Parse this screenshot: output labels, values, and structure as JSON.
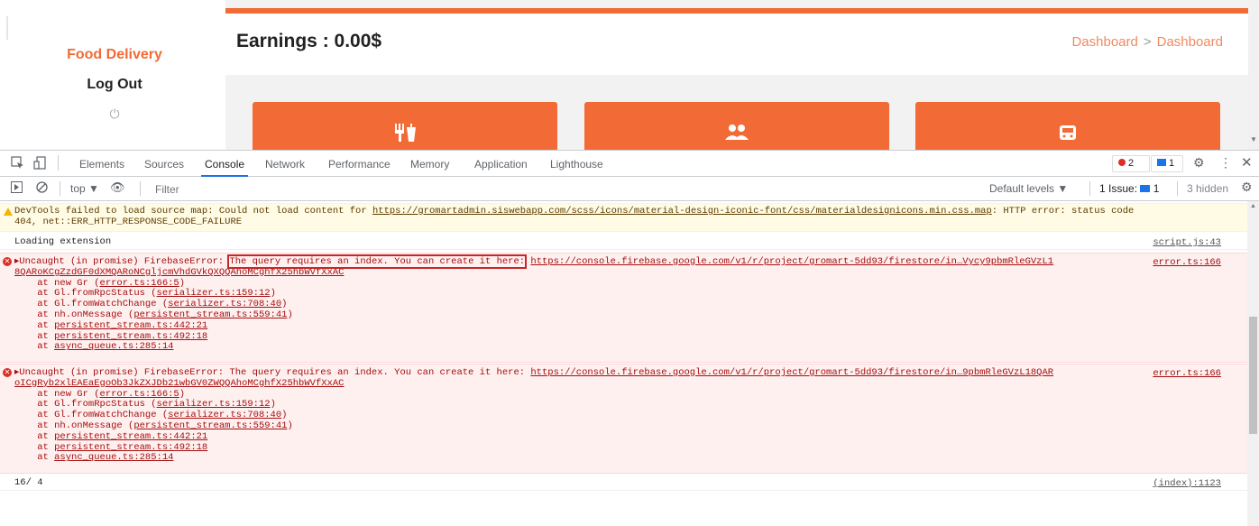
{
  "page": {
    "brand": "Food Delivery",
    "logout_label": "Log Out",
    "earnings_title": "Earnings : 0.00$",
    "breadcrumb": [
      "Dashboard",
      "Dashboard"
    ],
    "accent_color": "#f26a35",
    "cards": [
      {
        "icon": "utensils-icon"
      },
      {
        "icon": "users-icon"
      },
      {
        "icon": "car-icon"
      }
    ]
  },
  "devtools": {
    "tabs": [
      "Elements",
      "Sources",
      "Console",
      "Network",
      "Performance",
      "Memory",
      "Application",
      "Lighthouse"
    ],
    "active_tab": "Console",
    "error_count": "2",
    "message_count": "1",
    "context": "top ▼",
    "filter_placeholder": "Filter",
    "default_levels": "Default levels ▼",
    "issues_label": "1 Issue:",
    "issues_count": "1",
    "hidden_label": "3 hidden",
    "messages": {
      "warning": {
        "line1_prefix": "DevTools failed to load source map: Could not load content for ",
        "line1_link": "https://gromartadmin.siswebapp.com/scss/icons/material-design-iconic-font/css/materialdesignicons.min.css.map",
        "line1_suffix": ": HTTP error: status code",
        "line2": "404, net::ERR_HTTP_RESPONSE_CODE_FAILURE"
      },
      "loading": {
        "text": "Loading extension",
        "source": "script.js:43"
      },
      "error1": {
        "prefix": "▸Uncaught (in promise) FirebaseError: ",
        "highlight": "The query requires an index. You can create it here:",
        "link": "https://console.firebase.google.com/v1/r/project/gromart-5dd93/firestore/in…Vycy9pbmRleGVzL1",
        "link2": "8QARoKCgZzdGF0dXMQARoNCgljcmVhdGVkQXQQAhoMCghfX25hbWVfXxAC",
        "source": "error.ts:166",
        "stack": [
          {
            "pre": "    at new Gr (",
            "loc": "error.ts:166:5",
            "post": ")"
          },
          {
            "pre": "    at Gl.fromRpcStatus (",
            "loc": "serializer.ts:159:12",
            "post": ")"
          },
          {
            "pre": "    at Gl.fromWatchChange (",
            "loc": "serializer.ts:708:40",
            "post": ")"
          },
          {
            "pre": "    at nh.onMessage (",
            "loc": "persistent_stream.ts:559:41",
            "post": ")"
          },
          {
            "pre": "    at ",
            "loc": "persistent_stream.ts:442:21",
            "post": ""
          },
          {
            "pre": "    at ",
            "loc": "persistent_stream.ts:492:18",
            "post": ""
          },
          {
            "pre": "    at ",
            "loc": "async_queue.ts:285:14",
            "post": ""
          }
        ]
      },
      "error2": {
        "prefix": "▸Uncaught (in promise) FirebaseError: The query requires an index. You can create it here: ",
        "link": "https://console.firebase.google.com/v1/r/project/gromart-5dd93/firestore/in…9pbmRleGVzL18QAR",
        "link2": "oICgRyb2xlEAEaEgoOb3JkZXJDb21wbGV0ZWQQAhoMCghfX25hbWVfXxAC",
        "source": "error.ts:166",
        "stack": [
          {
            "pre": "    at new Gr (",
            "loc": "error.ts:166:5",
            "post": ")"
          },
          {
            "pre": "    at Gl.fromRpcStatus (",
            "loc": "serializer.ts:159:12",
            "post": ")"
          },
          {
            "pre": "    at Gl.fromWatchChange (",
            "loc": "serializer.ts:708:40",
            "post": ")"
          },
          {
            "pre": "    at nh.onMessage (",
            "loc": "persistent_stream.ts:559:41",
            "post": ")"
          },
          {
            "pre": "    at ",
            "loc": "persistent_stream.ts:442:21",
            "post": ""
          },
          {
            "pre": "    at ",
            "loc": "persistent_stream.ts:492:18",
            "post": ""
          },
          {
            "pre": "    at ",
            "loc": "async_queue.ts:285:14",
            "post": ""
          }
        ]
      },
      "last_log": {
        "text": "16/ 4",
        "source": "(index):1123"
      }
    }
  }
}
